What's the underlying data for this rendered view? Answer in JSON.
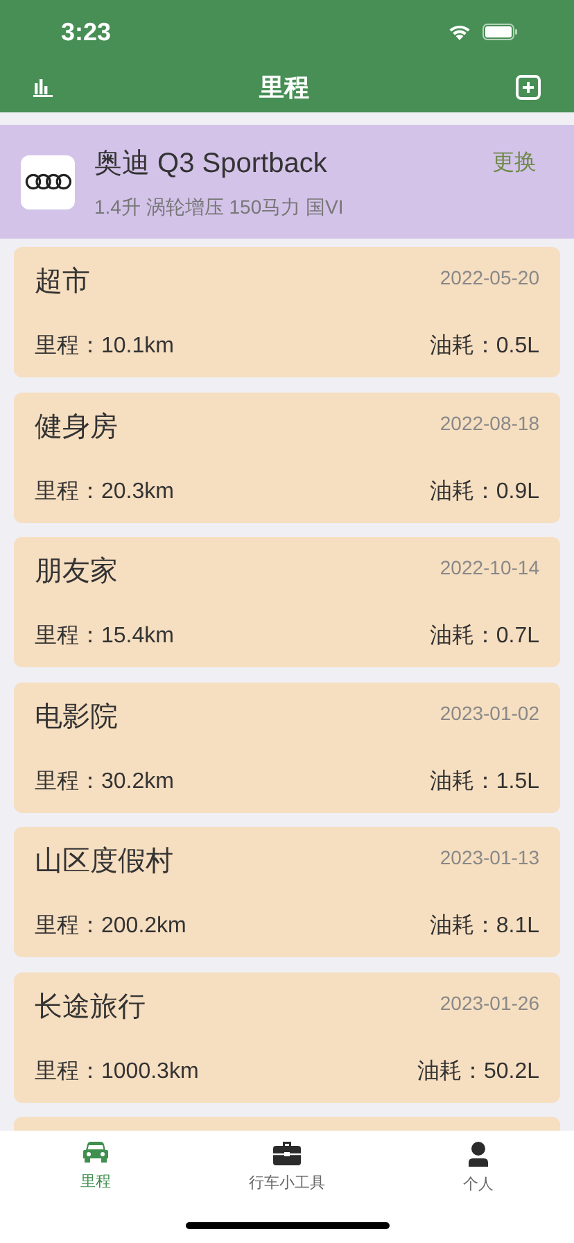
{
  "status_bar": {
    "time": "3:23"
  },
  "nav": {
    "title": "里程"
  },
  "car": {
    "name": "奥迪 Q3 Sportback",
    "spec": "1.4升 涡轮增压 150马力 国VI",
    "action": "更换"
  },
  "trips": [
    {
      "name": "超市",
      "date": "2022-05-20",
      "distance": "里程：10.1km",
      "fuel": "油耗：0.5L"
    },
    {
      "name": "健身房",
      "date": "2022-08-18",
      "distance": "里程：20.3km",
      "fuel": "油耗：0.9L"
    },
    {
      "name": "朋友家",
      "date": "2022-10-14",
      "distance": "里程：15.4km",
      "fuel": "油耗：0.7L"
    },
    {
      "name": "电影院",
      "date": "2023-01-02",
      "distance": "里程：30.2km",
      "fuel": "油耗：1.5L"
    },
    {
      "name": "山区度假村",
      "date": "2023-01-13",
      "distance": "里程：200.2km",
      "fuel": "油耗：8.1L"
    },
    {
      "name": "长途旅行",
      "date": "2023-01-26",
      "distance": "里程：1000.3km",
      "fuel": "油耗：50.2L"
    }
  ],
  "tab_bar": [
    {
      "label": "里程",
      "kind": "car",
      "selected": true
    },
    {
      "label": "行车小工具",
      "kind": "toolbox",
      "selected": false
    },
    {
      "label": "个人",
      "kind": "person",
      "selected": false
    }
  ]
}
